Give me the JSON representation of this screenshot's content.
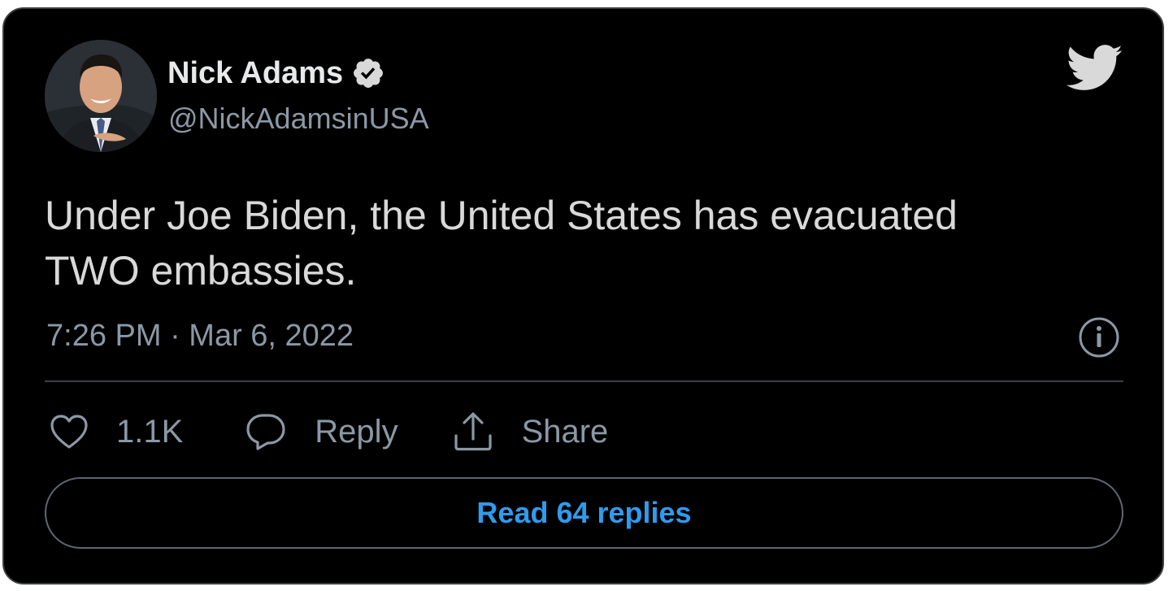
{
  "author": {
    "display_name": "Nick Adams",
    "handle": "@NickAdamsinUSA",
    "verified": true,
    "avatar_icon": "profile-photo"
  },
  "tweet": {
    "text": "Under Joe Biden, the United States has evacuated\nTWO embassies.",
    "timestamp": "7:26 PM · Mar 6, 2022"
  },
  "actions": {
    "like_count": "1.1K",
    "reply_label": "Reply",
    "share_label": "Share"
  },
  "read_replies_label": "Read 64 replies",
  "icons": {
    "brand": "twitter-bird-icon",
    "info": "info-icon",
    "like": "heart-icon",
    "reply": "speech-bubble-icon",
    "share": "share-upload-icon",
    "verified": "verified-badge-icon"
  },
  "colors": {
    "background": "#000000",
    "accent": "#2f9bec",
    "muted": "#8b98a5",
    "text": "#d9d9d9"
  }
}
